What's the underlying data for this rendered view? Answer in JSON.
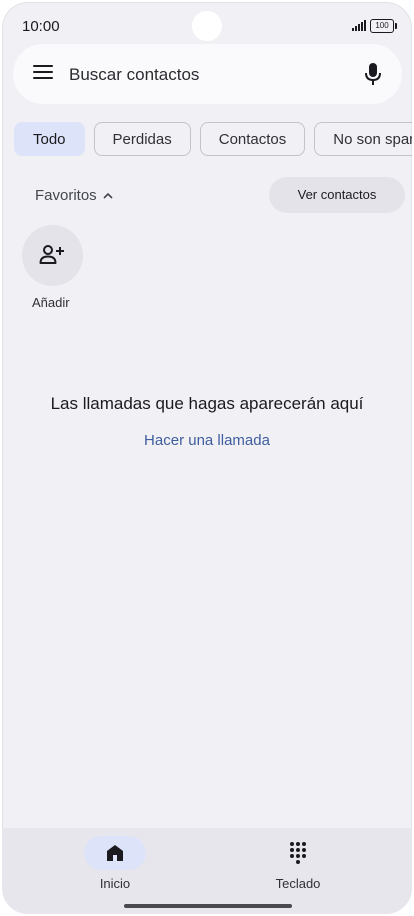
{
  "status_bar": {
    "time": "10:00",
    "battery": "100"
  },
  "search": {
    "placeholder": "Buscar contactos",
    "menu_icon": "menu-icon",
    "mic_icon": "mic-icon"
  },
  "chips": [
    {
      "label": "Todo",
      "active": true
    },
    {
      "label": "Perdidas",
      "active": false
    },
    {
      "label": "Contactos",
      "active": false
    },
    {
      "label": "No son spam",
      "active": false
    }
  ],
  "favorites": {
    "title": "Favoritos",
    "view_contacts": "Ver contactos",
    "add_label": "Añadir"
  },
  "empty_state": {
    "message": "Las llamadas que hagas aparecerán aquí",
    "action": "Hacer una llamada"
  },
  "bottom_nav": [
    {
      "label": "Inicio",
      "icon": "home-icon",
      "active": true
    },
    {
      "label": "Teclado",
      "icon": "dialpad-icon",
      "active": false
    }
  ],
  "colors": {
    "background": "#f1f0f5",
    "accent_chip": "#dde3f8",
    "link": "#3f5e9d"
  }
}
